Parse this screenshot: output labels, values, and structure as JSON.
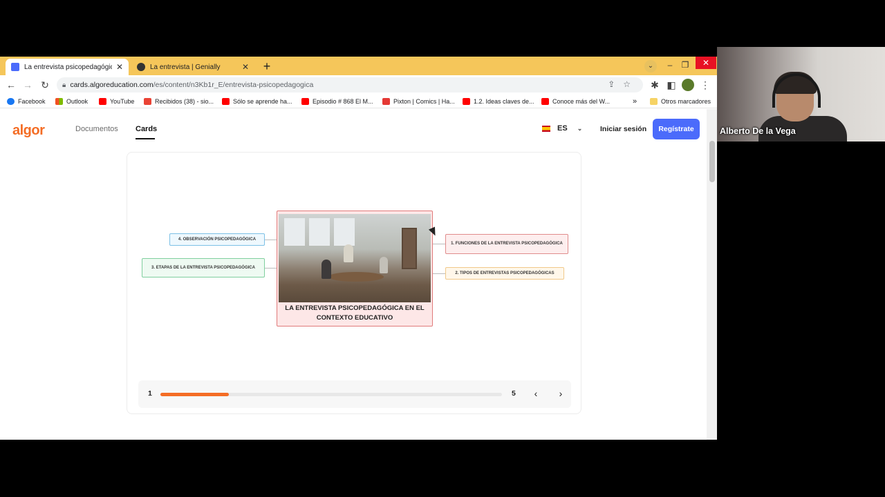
{
  "browser": {
    "tabs": [
      {
        "title": "La entrevista psicopedagógica en",
        "active": true,
        "favicon_color": "#4b6bfb"
      },
      {
        "title": "La entrevista | Genially",
        "active": false,
        "favicon_color": "#333333"
      }
    ],
    "new_tab_icon": "plus-icon",
    "url_host": "cards.algoreducation.com",
    "url_path": "/es/content/n3Kb1r_E/entrevista-psicopedagogica",
    "bookmarks": [
      {
        "label": "Facebook",
        "color": "#1877f2"
      },
      {
        "label": "Outlook",
        "color": "#f25022"
      },
      {
        "label": "YouTube",
        "color": "#ff0000"
      },
      {
        "label": "Recibidos (38) - sio...",
        "color": "#ea4335"
      },
      {
        "label": "Sólo se aprende ha...",
        "color": "#ff0000"
      },
      {
        "label": "Episodio # 868 El M...",
        "color": "#ff0000"
      },
      {
        "label": "Pixton | Comics | Ha...",
        "color": "#e53935"
      },
      {
        "label": "1.2. Ideas claves de...",
        "color": "#ff0000"
      },
      {
        "label": "Conoce más del W...",
        "color": "#ff0000"
      }
    ],
    "bookmarks_overflow": "»",
    "other_bookmarks": "Otros marcadores"
  },
  "site": {
    "logo": "algor",
    "nav": {
      "documents": "Documentos",
      "cards": "Cards"
    },
    "language": "ES",
    "login": "Iniciar sesión",
    "register": "Regístrate",
    "accent": "#f46d25",
    "button_color": "#4b6bfb"
  },
  "mindmap": {
    "center_title": "LA ENTREVISTA PSICOPEDAGÓGICA EN EL CONTEXTO EDUCATIVO",
    "nodes": {
      "n1": "1. FUNCIONES DE LA ENTREVISTA PSICOPEDAGÓGICA",
      "n2": "2. TIPOS DE ENTREVISTAS PSICOPEDAGÓGICAS",
      "n3": "3. ETAPAS DE LA ENTREVISTA PSICOPEDAGÓGICA",
      "n4": "4. OBSERVACIÓN PSICOPEDAGÓGICA"
    }
  },
  "pager": {
    "current": "1",
    "total": "5",
    "progress": 0.2
  },
  "webcam": {
    "name": "Alberto De la Vega"
  }
}
